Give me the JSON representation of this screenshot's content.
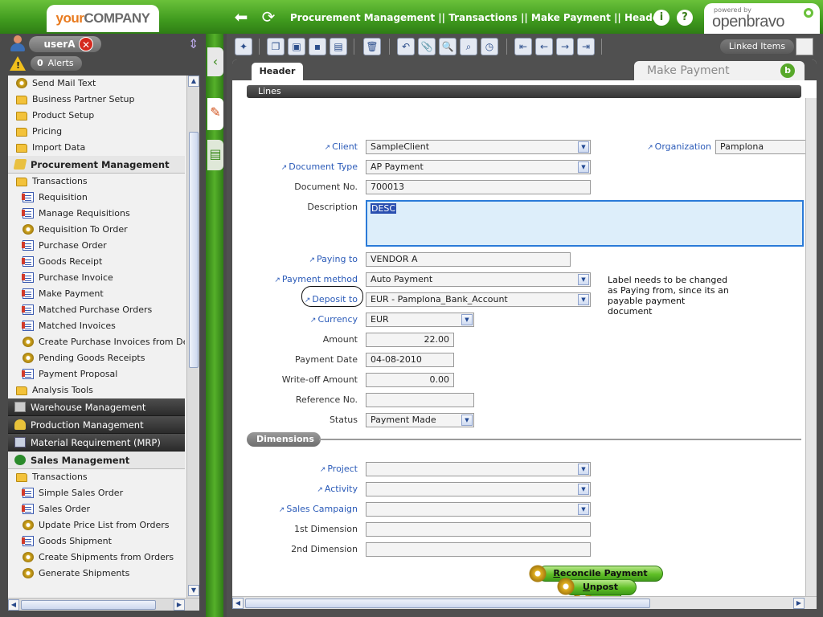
{
  "header": {
    "logo_your": "your",
    "logo_company": "COMPANY",
    "breadcrumb": "Procurement Management || Transactions || Make Payment || Header",
    "info_icon": "i",
    "help_icon": "?",
    "powered_by": "powered by",
    "brand": "openbravo"
  },
  "user": {
    "name": "userA",
    "alerts_count": "0",
    "alerts_label": "Alerts"
  },
  "menu": [
    {
      "label": "Send Mail Text",
      "type": "proc",
      "indent": 1
    },
    {
      "label": "Business Partner Setup",
      "type": "folder",
      "indent": 1
    },
    {
      "label": "Product Setup",
      "type": "folder",
      "indent": 1
    },
    {
      "label": "Pricing",
      "type": "folder",
      "indent": 1
    },
    {
      "label": "Import Data",
      "type": "folder",
      "indent": 1
    },
    {
      "label": "Procurement Management",
      "type": "section-light",
      "indent": 0
    },
    {
      "label": "Transactions",
      "type": "folder",
      "indent": 1
    },
    {
      "label": "Requisition",
      "type": "doc",
      "indent": 2
    },
    {
      "label": "Manage Requisitions",
      "type": "doc",
      "indent": 2
    },
    {
      "label": "Requisition To Order",
      "type": "proc",
      "indent": 2
    },
    {
      "label": "Purchase Order",
      "type": "doc",
      "indent": 2
    },
    {
      "label": "Goods Receipt",
      "type": "doc",
      "indent": 2
    },
    {
      "label": "Purchase Invoice",
      "type": "doc",
      "indent": 2
    },
    {
      "label": "Make Payment",
      "type": "doc",
      "indent": 2
    },
    {
      "label": "Matched Purchase Orders",
      "type": "doc",
      "indent": 2
    },
    {
      "label": "Matched Invoices",
      "type": "doc",
      "indent": 2
    },
    {
      "label": "Create Purchase Invoices from Deliveries",
      "type": "proc",
      "indent": 2
    },
    {
      "label": "Pending Goods Receipts",
      "type": "proc",
      "indent": 2
    },
    {
      "label": "Payment Proposal",
      "type": "doc",
      "indent": 2
    },
    {
      "label": "Analysis Tools",
      "type": "folder",
      "indent": 1
    },
    {
      "label": "Warehouse Management",
      "type": "section-dark",
      "indent": 0,
      "icon": "wh"
    },
    {
      "label": "Production Management",
      "type": "section-dark",
      "indent": 0,
      "icon": "prod"
    },
    {
      "label": "Material Requirement (MRP)",
      "type": "section-dark",
      "indent": 0,
      "icon": "mrp"
    },
    {
      "label": "Sales Management",
      "type": "section-light",
      "indent": 0,
      "icon": "sales"
    },
    {
      "label": "Transactions",
      "type": "folder",
      "indent": 1
    },
    {
      "label": "Simple Sales Order",
      "type": "doc",
      "indent": 2
    },
    {
      "label": "Sales Order",
      "type": "doc",
      "indent": 2
    },
    {
      "label": "Update Price List from Orders",
      "type": "proc",
      "indent": 2
    },
    {
      "label": "Goods Shipment",
      "type": "doc",
      "indent": 2
    },
    {
      "label": "Create Shipments from Orders",
      "type": "proc",
      "indent": 2
    },
    {
      "label": "Generate Shipments",
      "type": "proc",
      "indent": 2
    }
  ],
  "toolbar": {
    "linked_items": "Linked Items"
  },
  "tabs": {
    "header": "Header",
    "window_title": "Make Payment",
    "lines": "Lines"
  },
  "form": {
    "client_label": "Client",
    "client_value": "SampleClient",
    "organization_label": "Organization",
    "organization_value": "Pamplona",
    "doc_type_label": "Document Type",
    "doc_type_value": "AP Payment",
    "doc_no_label": "Document No.",
    "doc_no_value": "700013",
    "description_label": "Description",
    "description_value": "DESC",
    "paying_to_label": "Paying to",
    "paying_to_value": "VENDOR A",
    "payment_method_label": "Payment method",
    "payment_method_value": "Auto Payment",
    "deposit_to_label": "Deposit to",
    "deposit_to_value": "EUR - Pamplona_Bank_Account",
    "currency_label": "Currency",
    "currency_value": "EUR",
    "amount_label": "Amount",
    "amount_value": "22.00",
    "payment_date_label": "Payment Date",
    "payment_date_value": "04-08-2010",
    "writeoff_label": "Write-off Amount",
    "writeoff_value": "0.00",
    "reference_label": "Reference No.",
    "reference_value": "",
    "status_label": "Status",
    "status_value": "Payment Made",
    "note": "Label needs to be changed as Paying from, since its an payable  payment document"
  },
  "dimensions": {
    "title": "Dimensions",
    "project_label": "Project",
    "activity_label": "Activity",
    "sales_campaign_label": "Sales Campaign",
    "first_dim_label": "1st Dimension",
    "second_dim_label": "2nd Dimension"
  },
  "buttons": {
    "reconcile_first": "R",
    "reconcile_rest": "econcile Payment",
    "unpost_first": "U",
    "unpost_rest": "npost"
  }
}
